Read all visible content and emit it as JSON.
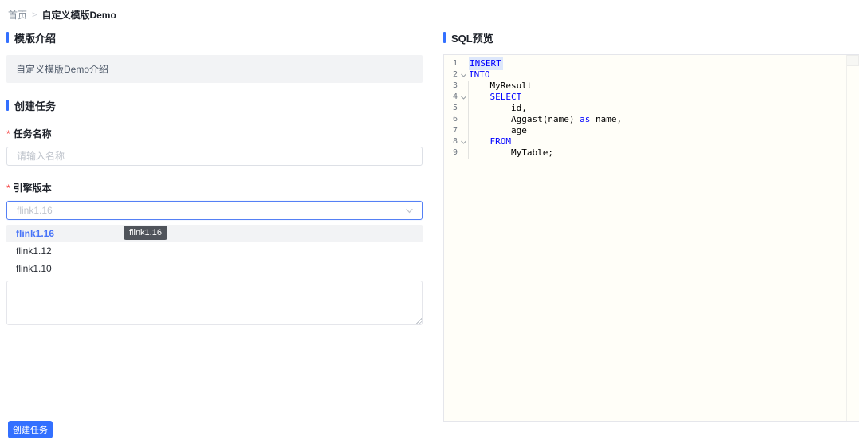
{
  "colors": {
    "accent": "#3370ff",
    "keyword_blue": "#0000ff",
    "selection_bg": "#dde7fb",
    "tooltip_bg": "#50545b",
    "required_red": "#f53f3f",
    "active_option_blue": "#4874f8"
  },
  "breadcrumb": {
    "home": "首页",
    "separator": ">",
    "current": "自定义模版Demo"
  },
  "left": {
    "intro_section": {
      "title": "模版介绍",
      "content": "自定义模版Demo介绍"
    },
    "form_section": {
      "title": "创建任务",
      "required_mark": "*",
      "task_name": {
        "label": "任务名称",
        "placeholder": "请输入名称",
        "value": ""
      },
      "engine_version": {
        "label": "引擎版本",
        "value": "flink1.16"
      },
      "dropdown_options": [
        {
          "label": "flink1.16",
          "state": "active"
        },
        {
          "label": "flink1.12",
          "state": "normal"
        },
        {
          "label": "flink1.10",
          "state": "normal"
        }
      ],
      "tooltip": "flink1.16"
    },
    "submit_button": "创建任务"
  },
  "sql_panel": {
    "title": "SQL预览",
    "lines": [
      {
        "number": "1",
        "fold": false,
        "indent": 0,
        "tokens": [
          {
            "text": "INSERT",
            "type": "keyword",
            "selected": true
          }
        ]
      },
      {
        "number": "2",
        "fold": true,
        "indent": 0,
        "tokens": [
          {
            "text": "INTO",
            "type": "keyword"
          }
        ]
      },
      {
        "number": "3",
        "fold": false,
        "indent": 1,
        "tokens": [
          {
            "text": "MyResult",
            "type": "plain"
          }
        ]
      },
      {
        "number": "4",
        "fold": true,
        "indent": 1,
        "tokens": [
          {
            "text": "SELECT",
            "type": "keyword"
          }
        ]
      },
      {
        "number": "5",
        "fold": false,
        "indent": 2,
        "tokens": [
          {
            "text": "id,",
            "type": "plain"
          }
        ]
      },
      {
        "number": "6",
        "fold": false,
        "indent": 2,
        "tokens": [
          {
            "text": "Aggast(name) ",
            "type": "plain"
          },
          {
            "text": "as",
            "type": "keyword"
          },
          {
            "text": " name,",
            "type": "plain"
          }
        ]
      },
      {
        "number": "7",
        "fold": false,
        "indent": 2,
        "tokens": [
          {
            "text": "age",
            "type": "plain"
          }
        ]
      },
      {
        "number": "8",
        "fold": true,
        "indent": 1,
        "tokens": [
          {
            "text": "FROM",
            "type": "keyword"
          }
        ]
      },
      {
        "number": "9",
        "fold": false,
        "indent": 2,
        "tokens": [
          {
            "text": "MyTable;",
            "type": "plain"
          }
        ]
      }
    ]
  }
}
